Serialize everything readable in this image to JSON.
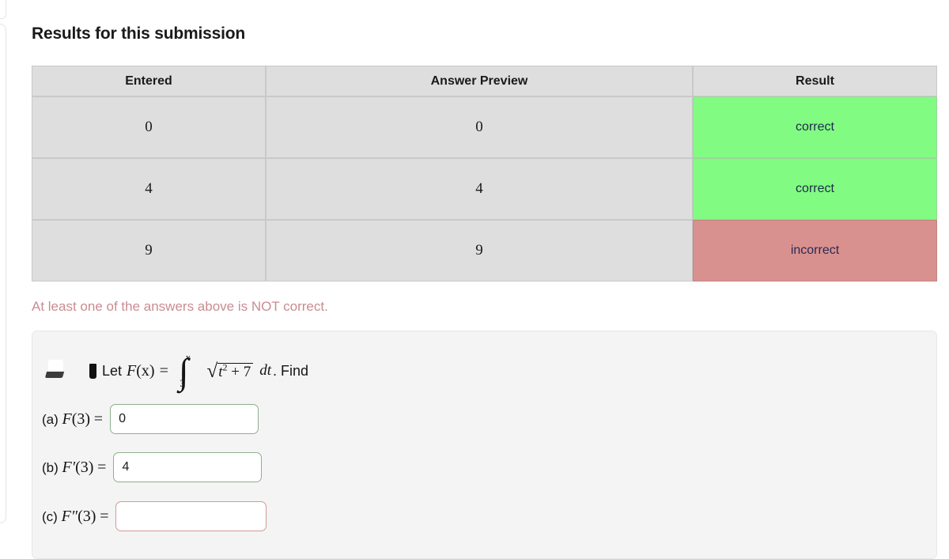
{
  "page": {
    "title": "Results for this submission",
    "warning": "At least one of the answers above is NOT correct."
  },
  "results_table": {
    "headers": [
      "Entered",
      "Answer Preview",
      "Result"
    ],
    "rows": [
      {
        "entered": "0",
        "preview": "0",
        "result": "correct",
        "status": "correct"
      },
      {
        "entered": "4",
        "preview": "4",
        "result": "correct",
        "status": "correct"
      },
      {
        "entered": "9",
        "preview": "9",
        "result": "incorrect",
        "status": "incorrect"
      }
    ],
    "colors": {
      "header_bg": "#dedede",
      "cell_bg": "#dedede",
      "correct_bg": "#82fb82",
      "incorrect_bg": "#d9918f",
      "result_text": "#2b2a52",
      "warning_text": "#c98c92"
    }
  },
  "problem": {
    "statement_prefix": "Let",
    "function_name": "F",
    "function_arg": "(x)",
    "equals": "=",
    "integral": {
      "lower_limit": "3",
      "upper_limit": "x",
      "integrand_radicand_base": "t",
      "integrand_radicand_exponent": "2",
      "integrand_plus": "+ 7",
      "differential": "dt"
    },
    "statement_suffix": ". Find",
    "answers": [
      {
        "label_letter": "(a)",
        "label_fn": "F",
        "label_prime": "",
        "label_arg": "(3)",
        "equals": "=",
        "value": "",
        "entered": "0",
        "state": "correct"
      },
      {
        "label_letter": "(b)",
        "label_fn": "F",
        "label_prime": "′",
        "label_arg": "(3)",
        "equals": "=",
        "value": "",
        "entered": "4",
        "state": "correct"
      },
      {
        "label_letter": "(c)",
        "label_fn": "F",
        "label_prime": "″",
        "label_arg": "(3)",
        "equals": "=",
        "value": "",
        "entered": "",
        "state": "incorrect"
      }
    ]
  },
  "icons": {
    "drag_marker": "drag-marker-icon",
    "bullet_marker": "bullet-marker-icon"
  }
}
